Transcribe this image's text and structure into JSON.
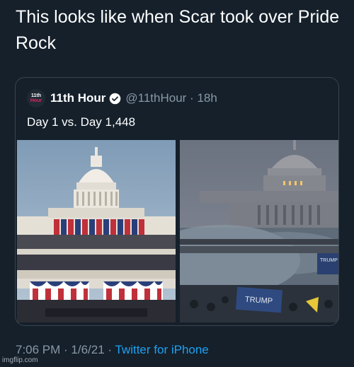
{
  "tweet": {
    "text": "This looks like when Scar took over Pride Rock"
  },
  "quoted_tweet": {
    "avatar_logo_top": "11th",
    "avatar_logo_bottom": "Hour",
    "display_name": "11th Hour",
    "verified_icon": "verified-badge-icon",
    "handle_time": "@11thHour · 18h",
    "text": "Day 1 vs. Day 1,448",
    "sign_text_1": "TRUMP",
    "sign_text_2": "TRUMP"
  },
  "footer": {
    "time_date": "7:06 PM · 1/6/21 · ",
    "source": "Twitter for iPhone"
  },
  "watermark": "imgflip.com",
  "colors": {
    "background": "#15202b",
    "muted": "#8899a6",
    "link": "#1da1f2",
    "border": "#38444d"
  }
}
